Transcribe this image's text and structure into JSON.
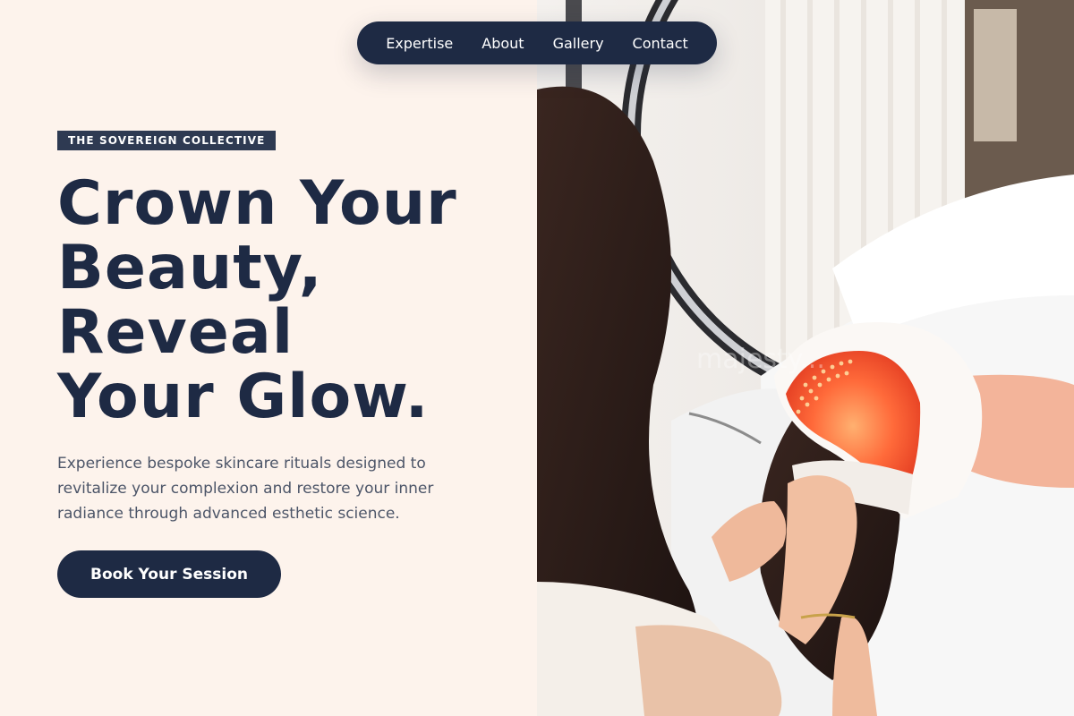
{
  "nav": {
    "links": [
      "Expertise",
      "About",
      "Gallery",
      "Contact"
    ]
  },
  "hero": {
    "badge": "THE SOVEREIGN COLLECTIVE",
    "headline_lines": [
      "Crown Your",
      "Beauty,",
      "Reveal",
      "Your Glow."
    ],
    "subtext_lines": [
      "Experience bespoke skincare rituals designed to",
      "revitalize your complexion and restore your inner",
      "radiance through advanced esthetic science."
    ],
    "cta_label": "Book Your Session"
  },
  "photo": {
    "watermark": "majesty..."
  },
  "colors": {
    "navy": "#1e2a44",
    "cream": "#fdf3ec",
    "body_text": "#4c5568",
    "led_red": "#f04a2a"
  }
}
